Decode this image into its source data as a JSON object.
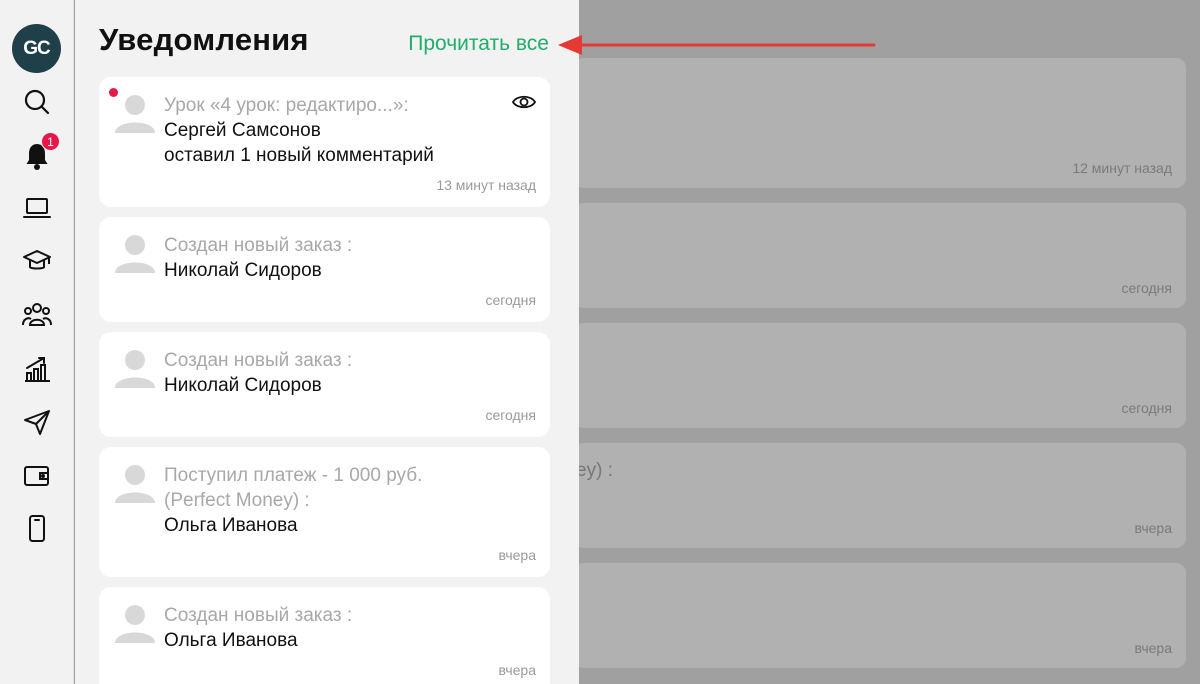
{
  "sidebar": {
    "logo": "GC",
    "bell_badge": "1",
    "icons": [
      "search-icon",
      "bell-icon",
      "laptop-icon",
      "graduation-cap-icon",
      "users-icon",
      "chart-icon",
      "send-icon",
      "wallet-icon",
      "phone-icon"
    ]
  },
  "panel": {
    "title": "Уведомления",
    "read_all": "Прочитать все"
  },
  "notifications": [
    {
      "subject": "Урок «4 урок: редактиро...»:",
      "line1": "Сергей Самсонов",
      "line2": "оставил 1 новый комментарий",
      "time": "13 минут назад"
    },
    {
      "subject": "Создан новый заказ :",
      "line1": "Николай Сидоров",
      "time": "сегодня"
    },
    {
      "subject": "Создан новый заказ :",
      "line1": "Николай Сидоров",
      "time": "сегодня"
    },
    {
      "subject": "Поступил платеж - 1 000 руб. (Perfect Money) :",
      "line1": "Ольга Иванова",
      "time": "вчера"
    },
    {
      "subject": "Создан новый заказ :",
      "line1": "Ольга Иванова",
      "time": "вчера"
    }
  ],
  "background": {
    "times": [
      "12 минут назад",
      "сегодня",
      "сегодня",
      "вчера",
      "вчера"
    ],
    "fragment": "ey) :"
  },
  "colors": {
    "accent_green": "#1fae6b",
    "badge_red": "#e8174a",
    "arrow_red": "#e53935",
    "logo_bg": "#1f3f49"
  }
}
